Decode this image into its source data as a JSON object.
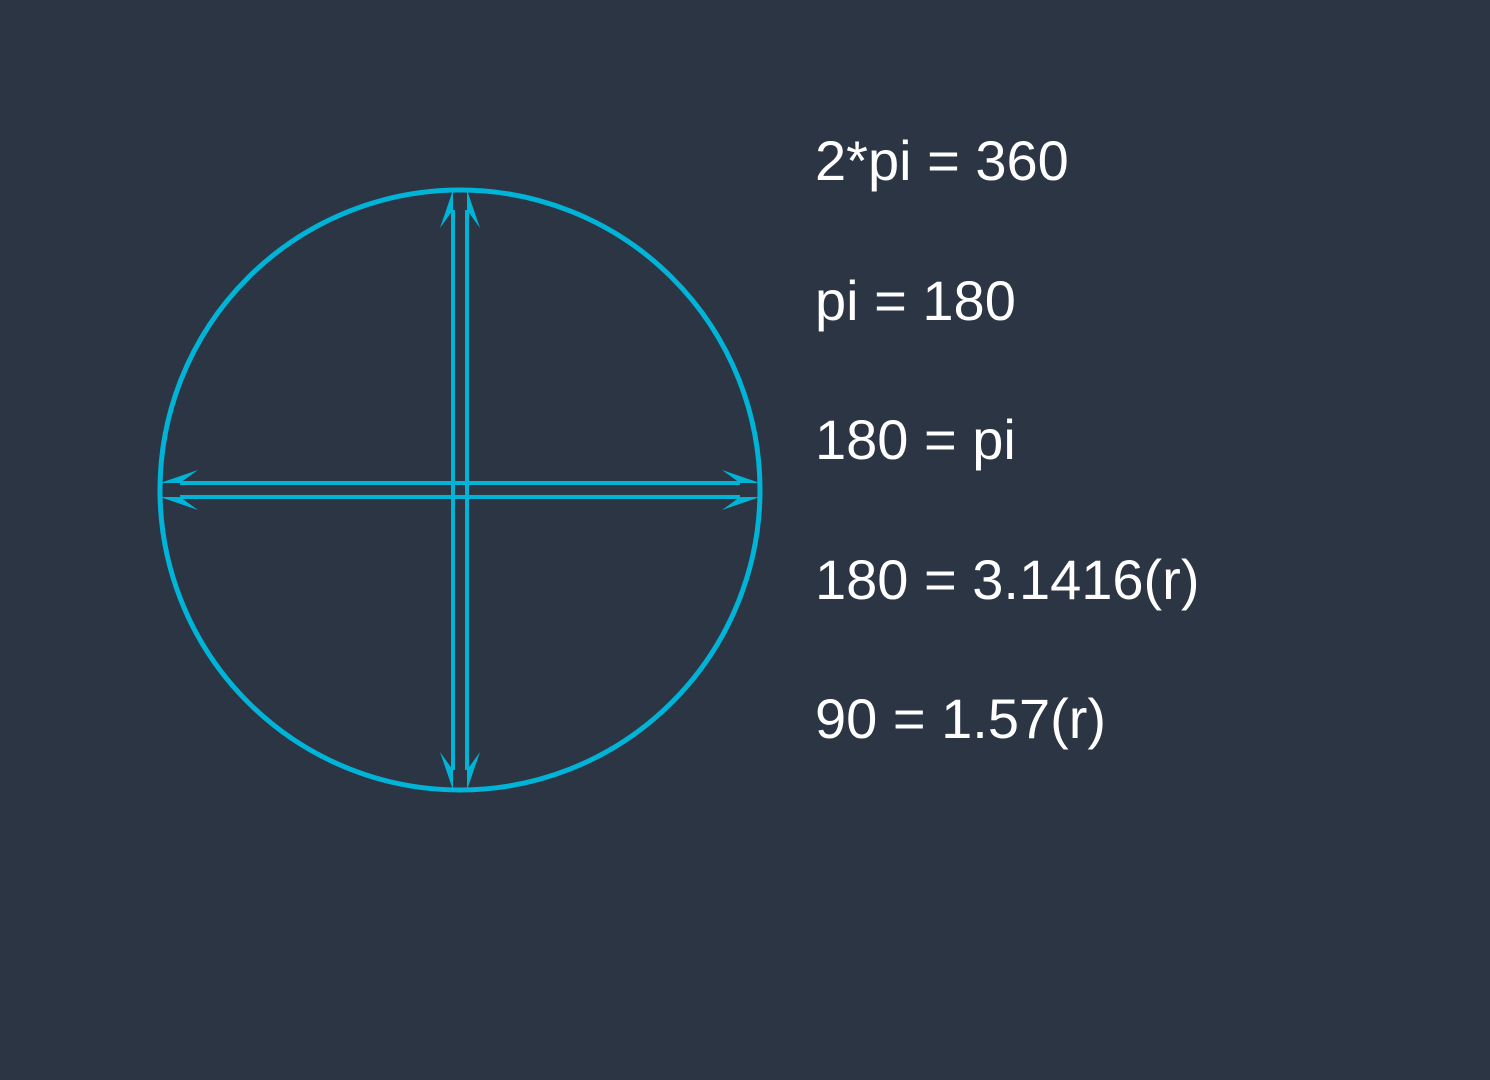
{
  "colors": {
    "background": "#2b3544",
    "circle": "#00b4d8",
    "text": "#ffffff"
  },
  "diagram": {
    "circle_radius": 300,
    "arrows": [
      "up",
      "down",
      "left",
      "right"
    ]
  },
  "equations": {
    "line1": "2*pi = 360",
    "line2": "pi = 180",
    "line3": "180 = pi",
    "line4": "180 = 3.1416(r)",
    "line5": "90 = 1.57(r)"
  }
}
